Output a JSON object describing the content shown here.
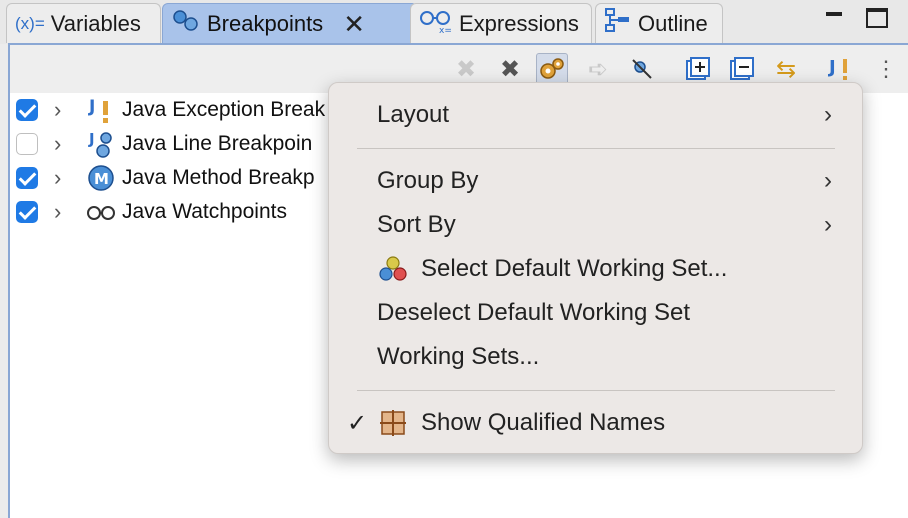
{
  "tabs": {
    "variables": {
      "label": "Variables",
      "icon": "variables-icon",
      "icon_text": "(x)="
    },
    "breakpoints": {
      "label": "Breakpoints",
      "icon": "breakpoints-icon",
      "close": "✕"
    },
    "expressions": {
      "label": "Expressions",
      "icon": "expressions-icon"
    },
    "outline": {
      "label": "Outline",
      "icon": "outline-icon"
    }
  },
  "tree": {
    "items": [
      {
        "label": "Java Exception Break",
        "checked": true,
        "icon": "exception-breakpoint-icon"
      },
      {
        "label": "Java Line Breakpoin",
        "checked": false,
        "icon": "line-breakpoint-icon"
      },
      {
        "label": "Java Method Breakp",
        "checked": true,
        "icon": "method-breakpoint-icon"
      },
      {
        "label": "Java Watchpoints",
        "checked": true,
        "icon": "watchpoint-icon"
      }
    ]
  },
  "menu": {
    "layout": "Layout",
    "group_by": "Group By",
    "sort_by": "Sort By",
    "select_default": "Select Default Working Set...",
    "deselect_default": "Deselect Default Working Set",
    "working_sets": "Working Sets...",
    "show_qualified": "Show Qualified Names",
    "show_qualified_checked": true
  },
  "colors": {
    "active_tab": "#a9c3ea",
    "checkbox": "#1f7ae5",
    "menu_bg": "#ece8e6"
  }
}
